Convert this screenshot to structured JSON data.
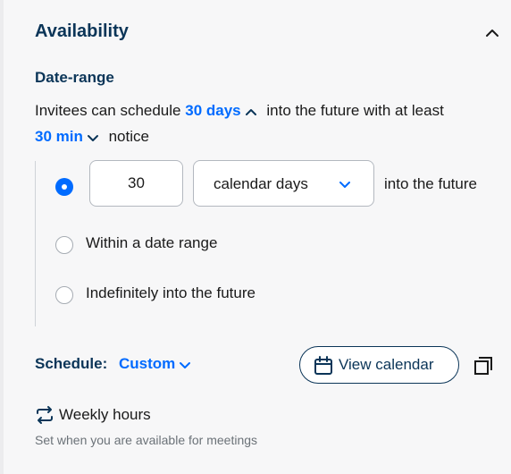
{
  "section": {
    "title": "Availability"
  },
  "date_range": {
    "title": "Date-range",
    "sentence": {
      "prefix": "Invitees can schedule",
      "days_link": "30 days",
      "middle": "into the future with at least",
      "notice_link": "30 min",
      "suffix": "notice"
    },
    "options": [
      {
        "selected": true,
        "number_value": "30",
        "unit_select": "calendar days",
        "trailing": "into the future"
      },
      {
        "selected": false,
        "label": "Within a date range"
      },
      {
        "selected": false,
        "label": "Indefinitely into the future"
      }
    ]
  },
  "schedule": {
    "label": "Schedule:",
    "value": "Custom",
    "view_calendar": "View calendar"
  },
  "weekly_hours": {
    "title": "Weekly hours",
    "hint": "Set when you are available for meetings"
  },
  "colors": {
    "accent": "#006bff",
    "heading": "#0b3558",
    "muted": "#6b7278"
  },
  "icons": [
    "chevron-up-icon",
    "chevron-down-icon",
    "calendar-icon",
    "copy-icon",
    "repeat-icon"
  ]
}
